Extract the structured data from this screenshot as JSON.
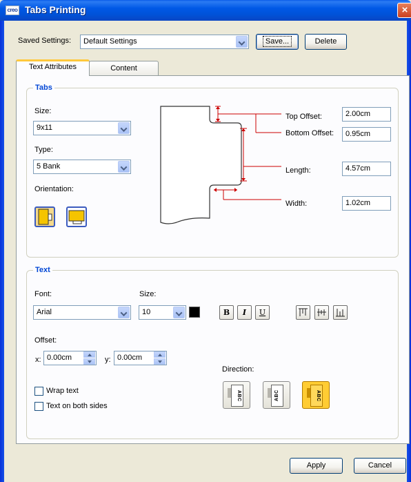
{
  "window": {
    "title": "Tabs Printing",
    "app_icon_text": "creo",
    "close_glyph": "×"
  },
  "saved_settings": {
    "label": "Saved Settings:",
    "value": "Default Settings",
    "save_label": "Save...",
    "delete_label": "Delete"
  },
  "tabs": [
    {
      "label": "Text Attributes",
      "active": true
    },
    {
      "label": "Content",
      "active": false
    }
  ],
  "tabs_group": {
    "title": "Tabs",
    "size_label": "Size:",
    "size_value": "9x11",
    "type_label": "Type:",
    "type_value": "5 Bank",
    "orientation_label": "Orientation:",
    "top_offset_label": "Top Offset:",
    "top_offset_value": "2.00cm",
    "bottom_offset_label": "Bottom Offset:",
    "bottom_offset_value": "0.95cm",
    "length_label": "Length:",
    "length_value": "4.57cm",
    "width_label": "Width:",
    "width_value": "1.02cm",
    "dimension_color": "#cc0000"
  },
  "text_group": {
    "title": "Text",
    "font_label": "Font:",
    "font_value": "Arial",
    "size_label": "Size:",
    "size_value": "10",
    "bold_glyph": "B",
    "italic_glyph": "I",
    "underline_glyph": "U",
    "offset_label": "Offset:",
    "x_label": "x:",
    "x_value": "0.00cm",
    "y_label": "y:",
    "y_value": "0.00cm",
    "wrap_text_label": "Wrap text",
    "both_sides_label": "Text on both sides",
    "direction_label": "Direction:",
    "direction_sample": "ABC",
    "accent_color": "#ffcc33"
  },
  "footer": {
    "apply_label": "Apply",
    "cancel_label": "Cancel"
  }
}
